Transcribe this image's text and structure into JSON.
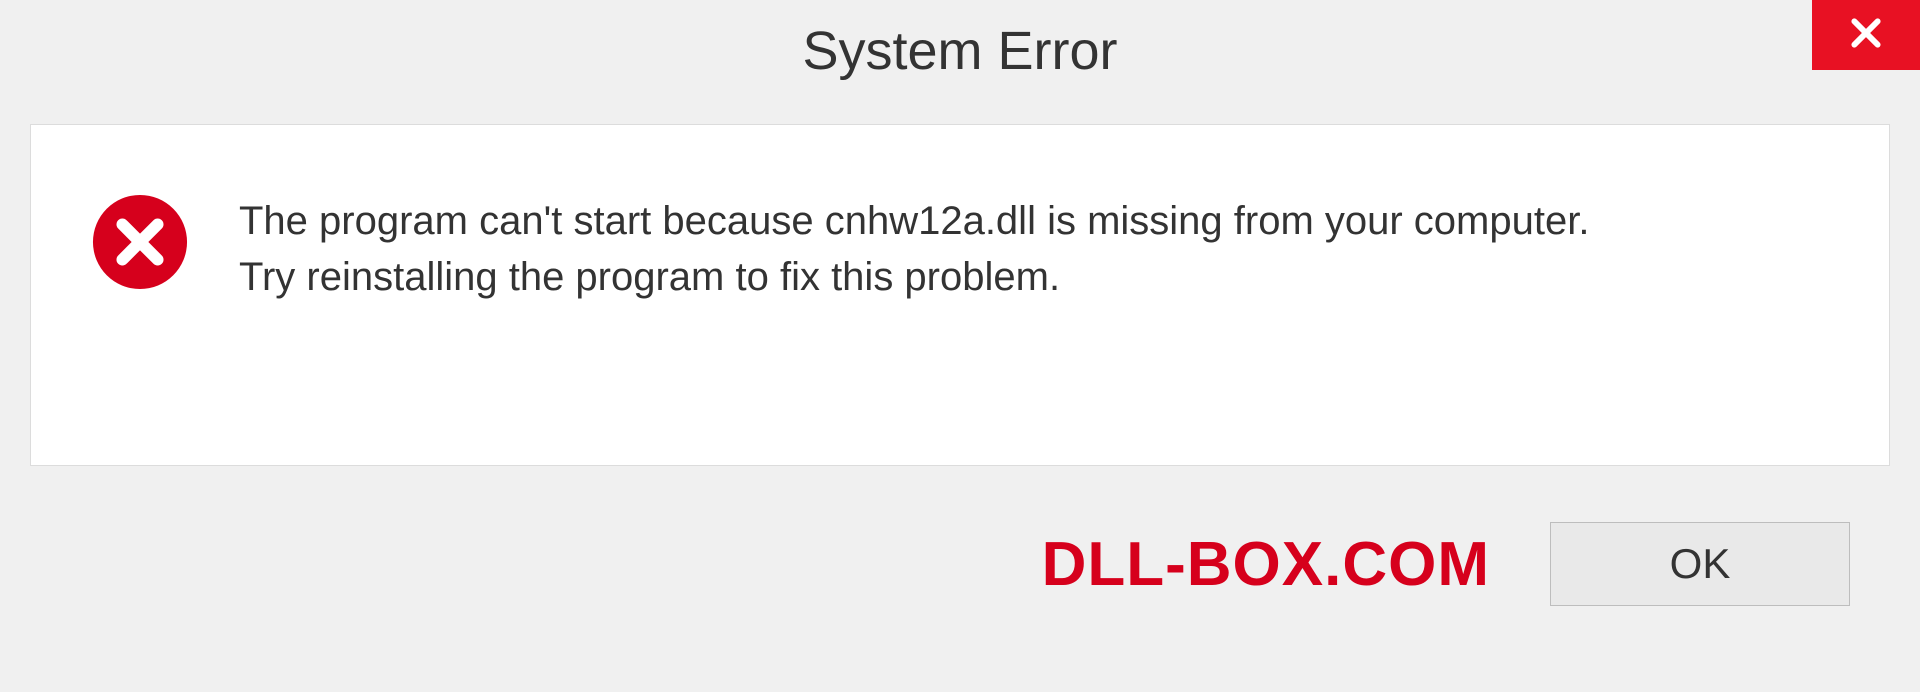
{
  "dialog": {
    "title": "System Error",
    "message_line1": "The program can't start because cnhw12a.dll is missing from your computer.",
    "message_line2": "Try reinstalling the program to fix this problem.",
    "ok_label": "OK"
  },
  "watermark": "DLL-BOX.COM",
  "icons": {
    "close": "close-icon",
    "error": "error-icon"
  },
  "colors": {
    "accent_red": "#e81123",
    "brand_red": "#d6001c",
    "panel_bg": "#ffffff",
    "body_bg": "#f0f0f0"
  }
}
